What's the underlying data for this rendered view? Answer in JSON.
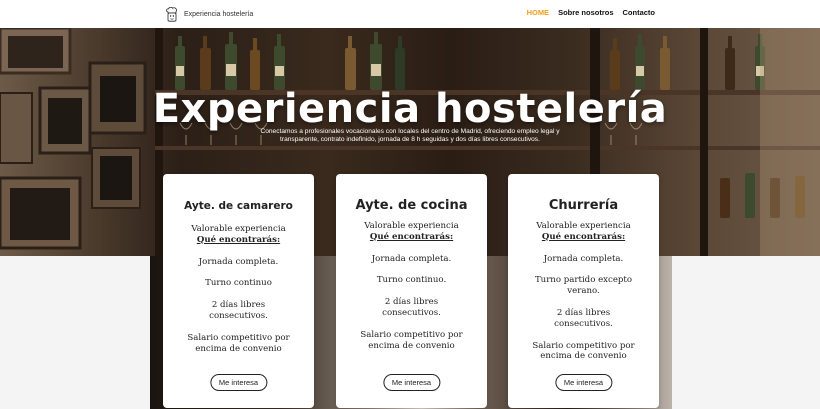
{
  "header": {
    "brand_name": "Experiencia hostelería",
    "logo_icon": "chef-logo-icon",
    "nav": [
      {
        "label": "HOME",
        "active": true
      },
      {
        "label": "Sobre nosotros",
        "active": false
      },
      {
        "label": "Contacto",
        "active": false
      }
    ],
    "active_color": "#f0a01e"
  },
  "hero": {
    "title": "Experiencia hostelería",
    "subtitle": "Conectamos a profesionales vocacionales con locales del centro de Madrid, ofreciendo empleo legal y transparente, contrato indefinido, jornada de 8 h seguidas y dos días libres consecutivos."
  },
  "cards": [
    {
      "title": "Ayte. de camarero",
      "lines": [
        "Valorable experiencia",
        "Qué encontrarás:",
        "",
        "Jornada completa.",
        "",
        "Turno continuo",
        "",
        "2 días libres consecutivos.",
        "",
        "Salario competitivo por encima de convenio"
      ],
      "button": "Me interesa"
    },
    {
      "title": "Ayte. de cocina",
      "lines": [
        "Valorable experiencia",
        "Qué encontrarás:",
        "",
        "Jornada completa.",
        "",
        "Turno continuo.",
        "",
        "2 días libres consecutivos.",
        "",
        "Salario competitivo por encima de convenio"
      ],
      "button": "Me interesa"
    },
    {
      "title": "Churrería",
      "lines": [
        "Valorable experiencia",
        "Qué encontrarás:",
        "",
        "Jornada completa.",
        "",
        "Turno partido excepto verano.",
        "",
        "2 días libres consecutivos.",
        "",
        "Salario competitivo por encima de convenio"
      ],
      "button": "Me interesa"
    }
  ]
}
